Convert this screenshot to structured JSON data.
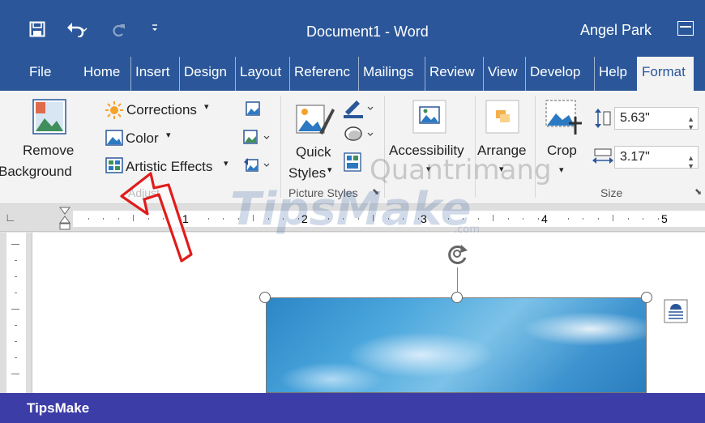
{
  "titlebar": {
    "doc_title": "Document1  -  Word",
    "user": "Angel Park",
    "bg": "#2b579a"
  },
  "tabs": [
    {
      "label": "File"
    },
    {
      "label": "Home"
    },
    {
      "label": "Insert"
    },
    {
      "label": "Design"
    },
    {
      "label": "Layout"
    },
    {
      "label": "Referenc"
    },
    {
      "label": "Mailings"
    },
    {
      "label": "Review"
    },
    {
      "label": "View"
    },
    {
      "label": "Develop"
    },
    {
      "label": "Help"
    },
    {
      "label": "Format",
      "active": true
    }
  ],
  "ribbon": {
    "remove_background": [
      "Remove",
      "Background"
    ],
    "corrections": "Corrections",
    "color": "Color",
    "artistic_effects": "Artistic Effects",
    "adjust_label": "Adjust",
    "quick_styles": [
      "Quick",
      "Styles"
    ],
    "picture_styles_label": "Picture Styles",
    "accessibility": "Accessibility",
    "arrange": "Arrange",
    "crop": "Crop",
    "height": "5.63\"",
    "width": "3.17\"",
    "size_label": "Size"
  },
  "ruler_numbers": [
    "1",
    "2",
    "3",
    "4",
    "5"
  ],
  "watermarks": {
    "tipsmake": "TipsMake",
    "tipsmake_com": ".com",
    "quantrimang": "Quantrimang"
  },
  "footer": {
    "brand": "TipsMake",
    "bg": "#3d3da8"
  },
  "icons": [
    "save-icon",
    "undo-icon",
    "redo-icon",
    "customize-qat-icon",
    "ribbon-display-options-icon",
    "remove-background-icon",
    "corrections-icon",
    "color-icon",
    "artistic-effects-icon",
    "compress-pictures-icon",
    "change-picture-icon",
    "reset-picture-icon",
    "quick-styles-icon",
    "picture-border-icon",
    "picture-effects-icon",
    "picture-layout-icon",
    "accessibility-icon",
    "arrange-icon",
    "crop-icon",
    "shape-height-icon",
    "shape-width-icon",
    "rotate-handle-icon",
    "layout-options-icon",
    "red-arrow-annotation"
  ]
}
